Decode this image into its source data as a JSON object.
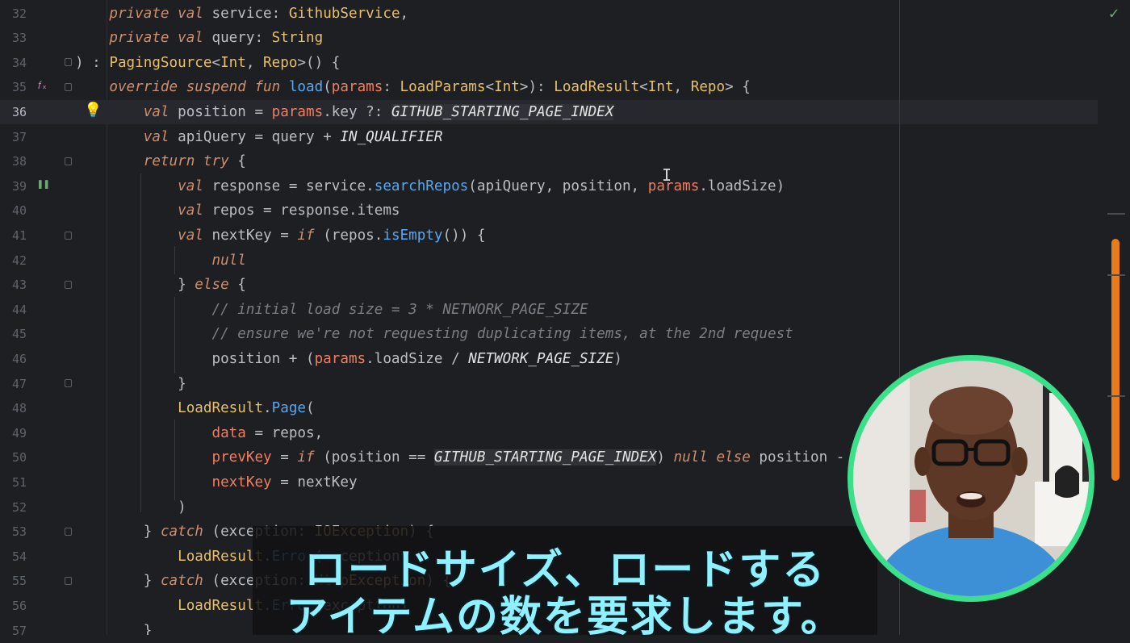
{
  "editor": {
    "lines": [
      {
        "n": "32",
        "html": "    <span class=\"kw\">private val</span> service: <span class=\"ty\">GithubService</span>,"
      },
      {
        "n": "33",
        "html": "    <span class=\"kw\">private val</span> query: <span class=\"ty\">String</span>"
      },
      {
        "n": "34",
        "html": ") : <span class=\"ty\">PagingSource</span>&lt;<span class=\"ty\">Int</span>, <span class=\"ty\">Repo</span>&gt;() {"
      },
      {
        "n": "35",
        "html": "    <span class=\"kw\">override suspend fun</span> <span class=\"fn\">load</span>(<span class=\"pa\">params</span>: <span class=\"ty\">LoadParams</span>&lt;<span class=\"ty\">Int</span>&gt;): <span class=\"ty\">LoadResult</span>&lt;<span class=\"ty\">Int</span>, <span class=\"ty\">Repo</span>&gt; {"
      },
      {
        "n": "36",
        "html": "        <span class=\"kw\">val</span> position = <span class=\"pa\">params</span>.key ?: <span class=\"cst hl\">GITHUB_STARTING_PAGE_INDEX</span>"
      },
      {
        "n": "37",
        "html": "        <span class=\"kw\">val</span> apiQuery = query + <span class=\"cst\">IN_QUALIFIER</span>"
      },
      {
        "n": "38",
        "html": "        <span class=\"kw\">return try</span> {"
      },
      {
        "n": "39",
        "html": "            <span class=\"kw\">val</span> response = service.<span class=\"fn\">searchRepos</span>(apiQuery, position, <span class=\"pa\">params</span>.loadSize)"
      },
      {
        "n": "40",
        "html": "            <span class=\"kw\">val</span> repos = response.items"
      },
      {
        "n": "41",
        "html": "            <span class=\"kw\">val</span> nextKey = <span class=\"kw\">if</span> (repos.<span class=\"fn\">isEmpty</span>()) {"
      },
      {
        "n": "42",
        "html": "                <span class=\"kw\">null</span>"
      },
      {
        "n": "43",
        "html": "            } <span class=\"kw\">else</span> {"
      },
      {
        "n": "44",
        "html": "                <span class=\"co\">// initial load size = 3 * NETWORK_PAGE_SIZE</span>"
      },
      {
        "n": "45",
        "html": "                <span class=\"co\">// ensure we're not requesting duplicating items, at the 2nd request</span>"
      },
      {
        "n": "46",
        "html": "                position + (<span class=\"pa\">params</span>.loadSize / <span class=\"cst\">NETWORK_PAGE_SIZE</span>)"
      },
      {
        "n": "47",
        "html": "            }"
      },
      {
        "n": "48",
        "html": "            <span class=\"ty\">LoadResult</span>.<span class=\"fn\">Page</span>("
      },
      {
        "n": "49",
        "html": "                <span class=\"nm\">data</span> = repos,"
      },
      {
        "n": "50",
        "html": "                <span class=\"nm\">prevKey</span> = <span class=\"kw\">if</span> (position == <span class=\"cst hl\">GITHUB_STARTING_PAGE_INDEX</span>) <span class=\"kw\">null else</span> position - <span class=\"num\">1</span>,"
      },
      {
        "n": "51",
        "html": "                <span class=\"nm\">nextKey</span> = nextKey"
      },
      {
        "n": "52",
        "html": "            )"
      },
      {
        "n": "53",
        "html": "        } <span class=\"kw\">catch</span> (exception: <span class=\"ty\">IOException</span>) {"
      },
      {
        "n": "54",
        "html": "            <span class=\"ty\">LoadResult</span>.<span class=\"fn\">Error</span>(exception)"
      },
      {
        "n": "55",
        "html": "        } <span class=\"kw\">catch</span> (exception: <span class=\"ty\">HttpException</span>) {"
      },
      {
        "n": "56",
        "html": "            <span class=\"ty\">LoadResult</span>.<span class=\"fn\">Error</span>(exception)"
      },
      {
        "n": "57",
        "html": "        }"
      }
    ]
  },
  "subtitle": {
    "line1": "ロードサイズ、ロードする",
    "line2": "アイテムの数を要求します。"
  },
  "status": {
    "check": "✓"
  },
  "colors": {
    "accent_scroll": "#e87b1a",
    "webcam_ring": "#3be08a",
    "subtitle_text": "#8ff0ff"
  }
}
